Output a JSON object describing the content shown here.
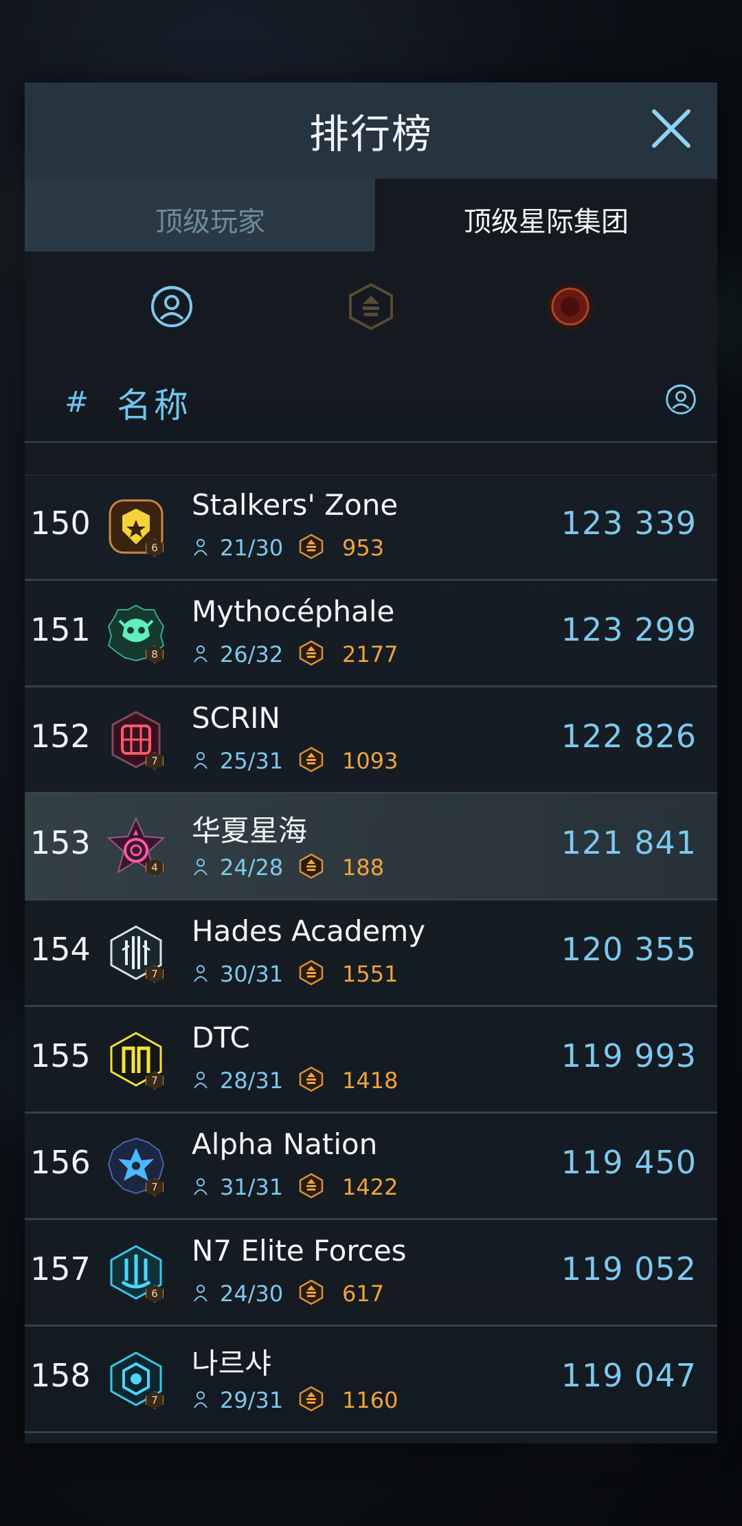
{
  "window": {
    "title": "排行榜",
    "close_icon": "close-icon"
  },
  "tabs": [
    {
      "label": "顶级玩家",
      "active": false
    },
    {
      "label": "顶级星际集团",
      "active": true
    }
  ],
  "filters": [
    {
      "icon": "member-radar-icon",
      "active": true
    },
    {
      "icon": "resource-icon",
      "active": false
    },
    {
      "icon": "red-planet-icon",
      "active": false
    }
  ],
  "columns": {
    "rank": "#",
    "name": "名称",
    "score_icon": "member-radar-icon"
  },
  "colors": {
    "accent_blue": "#7ec8ee",
    "resource_orange": "#f1a43a",
    "text_white": "#f4f6f8"
  },
  "rows": [
    {
      "rank": "150",
      "name": "Stalkers' Zone",
      "members": "21/30",
      "resource": "953",
      "score": "123 339",
      "level": "6",
      "emblem": "lion-emblem-icon",
      "highlight": false
    },
    {
      "rank": "151",
      "name": "Mythocéphale",
      "members": "26/32",
      "resource": "2177",
      "score": "123 299",
      "level": "8",
      "emblem": "demon-skull-emblem-icon",
      "highlight": false
    },
    {
      "rank": "152",
      "name": "SCRIN",
      "members": "25/31",
      "resource": "1093",
      "score": "122 826",
      "level": "7",
      "emblem": "crimson-grid-emblem-icon",
      "highlight": false
    },
    {
      "rank": "153",
      "name": "华夏星海",
      "members": "24/28",
      "resource": "188",
      "score": "121 841",
      "level": "4",
      "emblem": "pink-star-emblem-icon",
      "highlight": true
    },
    {
      "rank": "154",
      "name": "Hades Academy",
      "members": "30/31",
      "resource": "1551",
      "score": "120 355",
      "level": "7",
      "emblem": "white-glyph-emblem-icon",
      "highlight": false
    },
    {
      "rank": "155",
      "name": "DTC",
      "members": "28/31",
      "resource": "1418",
      "score": "119 993",
      "level": "7",
      "emblem": "yellow-gate-emblem-icon",
      "highlight": false
    },
    {
      "rank": "156",
      "name": "Alpha Nation",
      "members": "31/31",
      "resource": "1422",
      "score": "119 450",
      "level": "7",
      "emblem": "blue-crest-emblem-icon",
      "highlight": false
    },
    {
      "rank": "157",
      "name": "N7 Elite Forces",
      "members": "24/30",
      "resource": "617",
      "score": "119 052",
      "level": "6",
      "emblem": "cyan-trident-emblem-icon",
      "highlight": false
    },
    {
      "rank": "158",
      "name": "나르샤",
      "members": "29/31",
      "resource": "1160",
      "score": "119 047",
      "level": "7",
      "emblem": "cyan-hex-emblem-icon",
      "highlight": false
    }
  ]
}
